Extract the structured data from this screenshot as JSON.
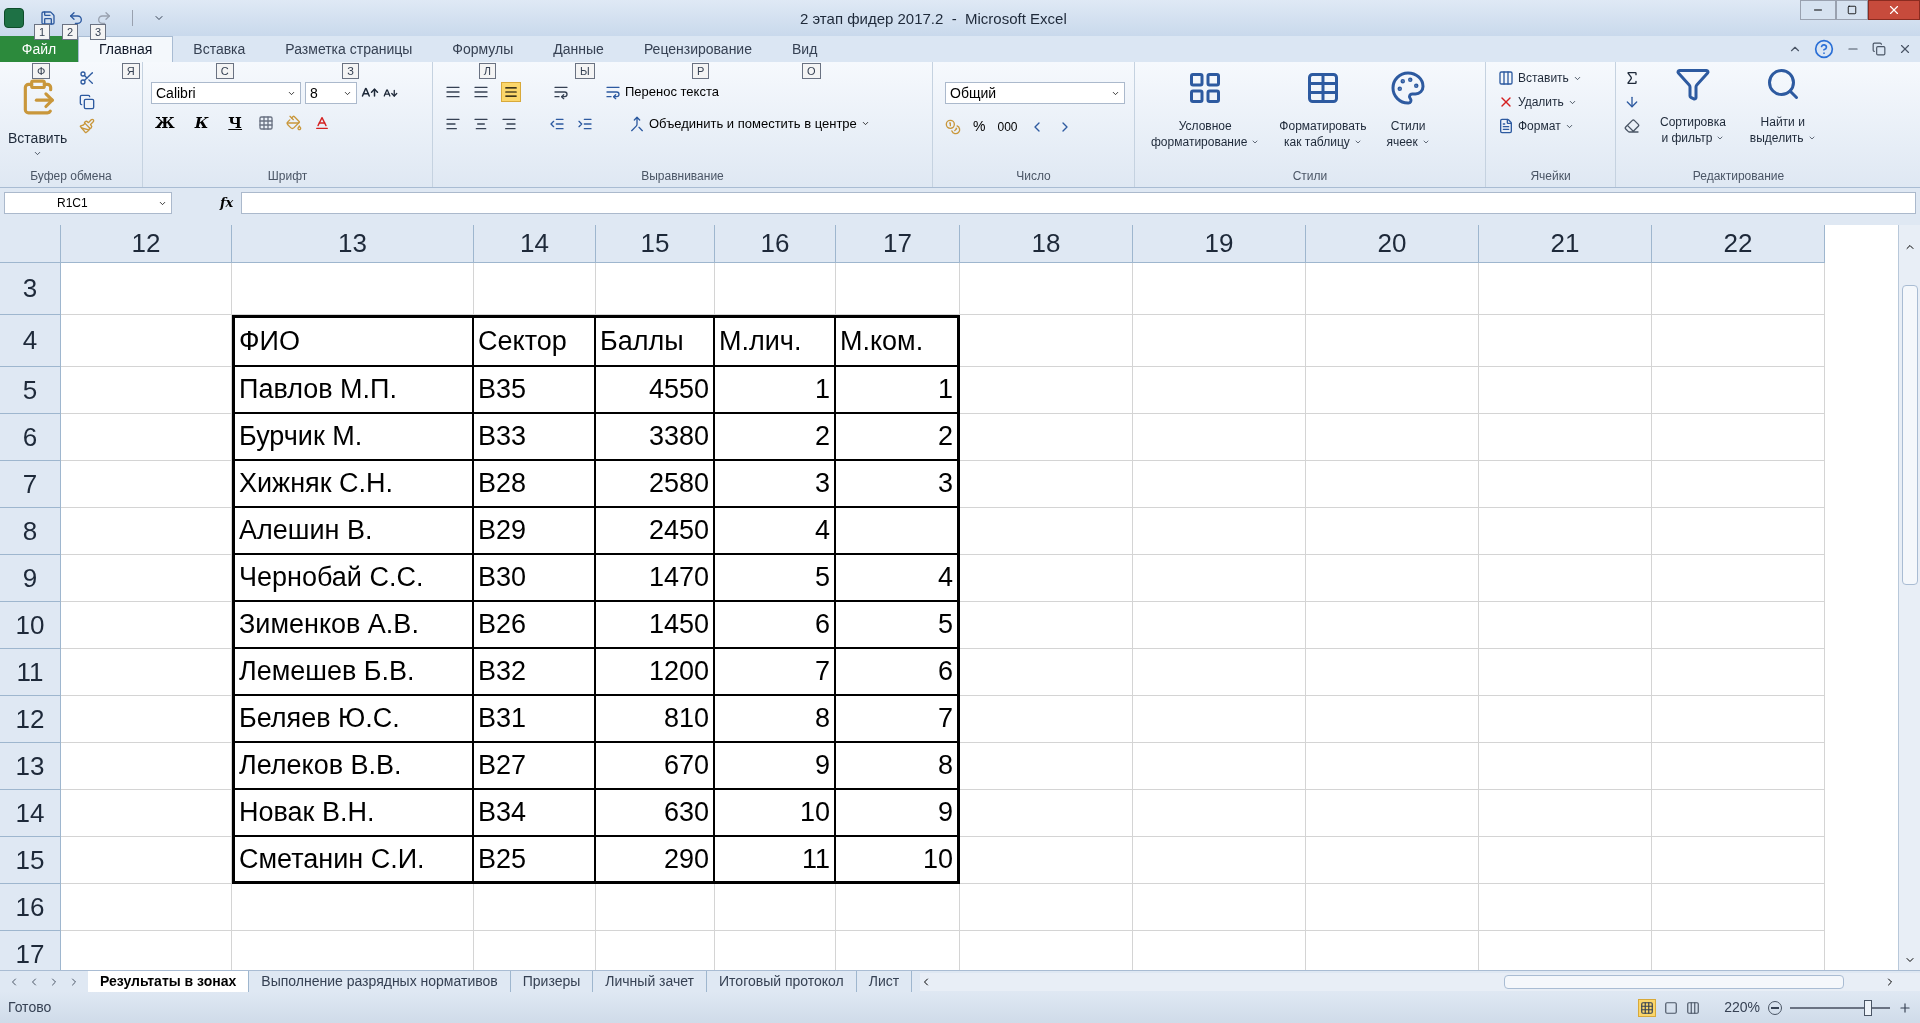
{
  "window": {
    "title": "2 этап фидер 2017.2  -  Microsoft Excel",
    "quick_access_keytips": [
      "1",
      "2",
      "3"
    ]
  },
  "tabs": [
    {
      "label": "Файл",
      "keytip": "Ф",
      "kind": "file",
      "selected": false
    },
    {
      "label": "Главная",
      "keytip": "Я",
      "kind": "tab",
      "selected": true
    },
    {
      "label": "Вставка",
      "keytip": "С",
      "kind": "tab",
      "selected": false
    },
    {
      "label": "Разметка страницы",
      "keytip": "З",
      "kind": "tab",
      "selected": false
    },
    {
      "label": "Формулы",
      "keytip": "Л",
      "kind": "tab",
      "selected": false
    },
    {
      "label": "Данные",
      "keytip": "Ы",
      "kind": "tab",
      "selected": false
    },
    {
      "label": "Рецензирование",
      "keytip": "Р",
      "kind": "tab",
      "selected": false
    },
    {
      "label": "Вид",
      "keytip": "О",
      "kind": "tab",
      "selected": false
    }
  ],
  "ribbon": {
    "clipboard": {
      "label": "Буфер обмена",
      "paste": "Вставить"
    },
    "font": {
      "label": "Шрифт",
      "font_name": "Calibri",
      "font_size": "8",
      "bold": "Ж",
      "italic": "К",
      "underline": "Ч"
    },
    "alignment": {
      "label": "Выравнивание",
      "wrap": "Перенос текста",
      "merge": "Объединить и поместить в центре"
    },
    "number": {
      "label": "Число",
      "format": "Общий",
      "percent": "%",
      "thousands": "000"
    },
    "styles": {
      "label": "Стили",
      "buttons": [
        [
          "Условное",
          "форматирование"
        ],
        [
          "Форматировать",
          "как таблицу"
        ],
        [
          "Стили",
          "ячеек"
        ]
      ]
    },
    "cells": {
      "label": "Ячейки",
      "buttons": [
        "Вставить",
        "Удалить",
        "Формат"
      ]
    },
    "editing": {
      "label": "Редактирование",
      "buttons": [
        [
          "Сортировка",
          "и фильтр"
        ],
        [
          "Найти и",
          "выделить"
        ]
      ]
    }
  },
  "formula_bar": {
    "name_box": "R1C1",
    "fx": "fx"
  },
  "columns": [
    "12",
    "13",
    "14",
    "15",
    "16",
    "17",
    "18",
    "19",
    "20",
    "21",
    "22"
  ],
  "rows": [
    {
      "header": "3",
      "kind": "blank"
    },
    {
      "header": "4",
      "kind": "header",
      "cells": [
        "ФИО",
        "Сектор",
        "Баллы",
        "М.лич.",
        "М.ком."
      ]
    },
    {
      "header": "5",
      "kind": "data",
      "cells": [
        "Павлов М.П.",
        "В35",
        "4550",
        "1",
        "1"
      ]
    },
    {
      "header": "6",
      "kind": "data",
      "cells": [
        "Бурчик М.",
        "В33",
        "3380",
        "2",
        "2"
      ]
    },
    {
      "header": "7",
      "kind": "data",
      "cells": [
        "Хижняк С.Н.",
        "В28",
        "2580",
        "3",
        "3"
      ]
    },
    {
      "header": "8",
      "kind": "data",
      "cells": [
        "Алешин В.",
        "В29",
        "2450",
        "4",
        null
      ]
    },
    {
      "header": "9",
      "kind": "data",
      "cells": [
        "Чернобай С.С.",
        "В30",
        "1470",
        "5",
        "4"
      ]
    },
    {
      "header": "10",
      "kind": "data",
      "cells": [
        "Зименков А.В.",
        "В26",
        "1450",
        "6",
        "5"
      ]
    },
    {
      "header": "11",
      "kind": "data",
      "cells": [
        "Лемешев Б.В.",
        "В32",
        "1200",
        "7",
        "6"
      ]
    },
    {
      "header": "12",
      "kind": "data",
      "cells": [
        "Беляев Ю.С.",
        "В31",
        "810",
        "8",
        "7"
      ]
    },
    {
      "header": "13",
      "kind": "data",
      "cells": [
        "Лелеков В.В.",
        "В27",
        "670",
        "9",
        "8"
      ]
    },
    {
      "header": "14",
      "kind": "data",
      "cells": [
        "Новак В.Н.",
        "В34",
        "630",
        "10",
        "9"
      ]
    },
    {
      "header": "15",
      "kind": "data",
      "cells": [
        "Сметанин С.И.",
        "В25",
        "290",
        "11",
        "10"
      ]
    },
    {
      "header": "16",
      "kind": "blank"
    },
    {
      "header": "17",
      "kind": "blank"
    }
  ],
  "sheet_tabs": [
    {
      "label": "Результаты в зонах",
      "selected": true
    },
    {
      "label": "Выполнение разрядных нормативов",
      "selected": false
    },
    {
      "label": "Призеры",
      "selected": false
    },
    {
      "label": "Личный зачет",
      "selected": false
    },
    {
      "label": "Итоговый протокол",
      "selected": false
    },
    {
      "label": "Лист",
      "selected": false
    }
  ],
  "status_bar": {
    "status": "Готово",
    "zoom": "220%",
    "level": 0.8
  }
}
